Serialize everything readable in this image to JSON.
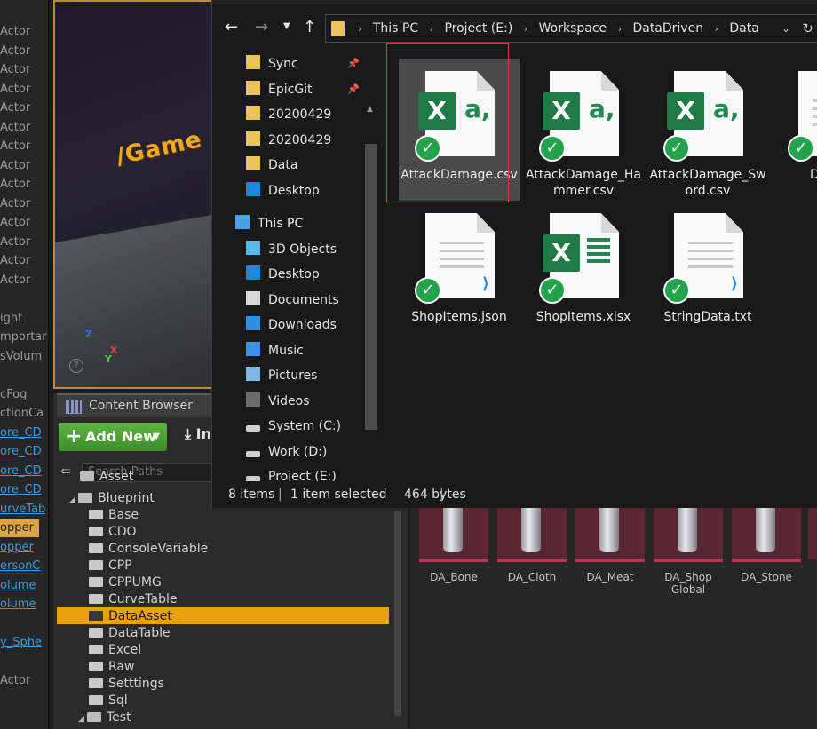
{
  "outliner": {
    "items": [
      "Actor",
      "Actor",
      "Actor",
      "Actor",
      "Actor",
      "Actor",
      "Actor",
      "Actor",
      "Actor",
      "Actor",
      "Actor",
      "Actor",
      "Actor",
      "Actor",
      "",
      "ight",
      "mportar",
      "sVolum",
      "",
      "cFog",
      "ctionCa",
      "ore_CD",
      "ore_CD",
      "ore_CD",
      "ore_CD",
      "urveTab",
      "opper",
      "opper",
      "ersonC",
      "olume",
      "olume",
      "",
      "y_Sphe",
      "",
      "Actor"
    ]
  },
  "viewport": {
    "game_text": "/Game"
  },
  "content_browser": {
    "tab_label": "Content Browser",
    "add_new_label": "Add New",
    "import_label": "In",
    "search_placeholder": "Search Paths",
    "tree": [
      {
        "label": "Asset"
      },
      {
        "label": "Blueprint"
      },
      {
        "label": "Base"
      },
      {
        "label": "CDO"
      },
      {
        "label": "ConsoleVariable"
      },
      {
        "label": "CPP"
      },
      {
        "label": "CPPUMG"
      },
      {
        "label": "CurveTable"
      },
      {
        "label": "DataAsset"
      },
      {
        "label": "DataTable"
      },
      {
        "label": "Excel"
      },
      {
        "label": "Raw"
      },
      {
        "label": "Setttings"
      },
      {
        "label": "Sql"
      },
      {
        "label": "Test"
      }
    ],
    "assets": [
      {
        "label": "DA_Bone"
      },
      {
        "label": "DA_Cloth"
      },
      {
        "label": "DA_Meat"
      },
      {
        "label": "DA_Shop Global Settings"
      },
      {
        "label": "DA_Stone"
      }
    ]
  },
  "explorer": {
    "breadcrumbs": [
      "This PC",
      "Project (E:)",
      "Workspace",
      "DataDriven",
      "Data"
    ],
    "nav": [
      {
        "label": "Sync",
        "icon": "folder-icon",
        "pinned": true
      },
      {
        "label": "EpicGit",
        "icon": "folder-icon",
        "pinned": true
      },
      {
        "label": "20200429",
        "icon": "folder-icon"
      },
      {
        "label": "20200429",
        "icon": "folder-icon"
      },
      {
        "label": "Data",
        "icon": "folder-icon"
      },
      {
        "label": "Desktop",
        "icon": "desktop-icon"
      },
      {
        "label": "This PC",
        "icon": "computer-icon"
      },
      {
        "label": "3D Objects",
        "icon": "cube-icon"
      },
      {
        "label": "Desktop",
        "icon": "desktop-icon"
      },
      {
        "label": "Documents",
        "icon": "documents-icon"
      },
      {
        "label": "Downloads",
        "icon": "download-icon"
      },
      {
        "label": "Music",
        "icon": "music-icon"
      },
      {
        "label": "Pictures",
        "icon": "pictures-icon"
      },
      {
        "label": "Videos",
        "icon": "videos-icon"
      },
      {
        "label": "System (C:)",
        "icon": "drive-icon"
      },
      {
        "label": "Work (D:)",
        "icon": "drive-icon"
      },
      {
        "label": "Project (E:)",
        "icon": "drive-icon"
      }
    ],
    "files": [
      {
        "name": "AttackDamage.csv",
        "type": "csv",
        "selected": true
      },
      {
        "name": "AttackDamage_Hammer.csv",
        "type": "csv"
      },
      {
        "name": "AttackDamage_Sword.csv",
        "type": "csv"
      },
      {
        "name": "DataDr",
        "type": "text"
      },
      {
        "name": "ShopItems.json",
        "type": "vscode"
      },
      {
        "name": "ShopItems.xlsx",
        "type": "xlsx"
      },
      {
        "name": "StringData.txt",
        "type": "vscode"
      }
    ],
    "status": {
      "item_count": "8 items",
      "selection": "1 item selected",
      "size": "464 bytes"
    }
  },
  "colors": {
    "ue_highlight": "#e8a10d",
    "add_new_green": "#4ea236",
    "excel_green": "#1f7a46",
    "selection_frame": "#e0393e",
    "sync_check": "#22a34a"
  }
}
